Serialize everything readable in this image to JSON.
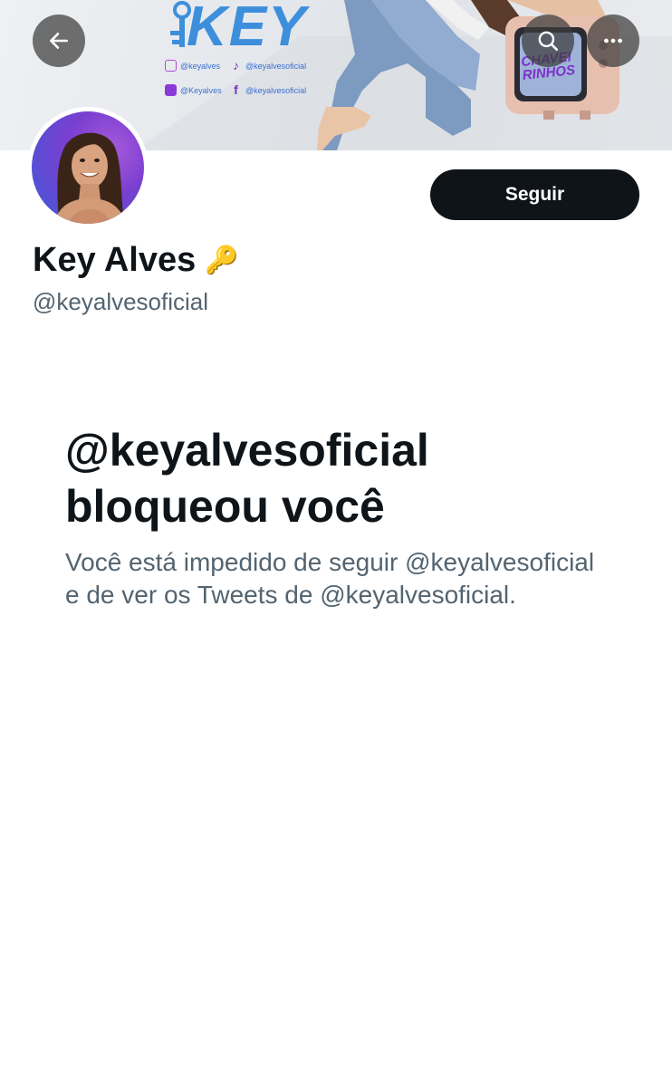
{
  "banner": {
    "brand": "KEY",
    "socials": [
      {
        "icon": "instagram-icon",
        "text": "@keyalves"
      },
      {
        "icon": "tiktok-icon",
        "text": "@keyalvesoficial"
      },
      {
        "icon": "kwai-icon",
        "text": "@Keyalves"
      },
      {
        "icon": "facebook-icon",
        "text": "@keyalvesoficial"
      }
    ],
    "tv_text_1": "CHAVEI",
    "tv_text_2": "RINHOS"
  },
  "toolbar": {
    "back_icon": "arrow-left-icon",
    "search_icon": "search-icon",
    "more_icon": "more-horizontal-icon"
  },
  "profile": {
    "display_name": "Key Alves",
    "name_emoji": "🔑",
    "handle": "@keyalvesoficial",
    "follow_label": "Seguir"
  },
  "blocked": {
    "title_line_1": "@keyalvesoficial",
    "title_line_2": "bloqueou você",
    "description_line_1": "Você está impedido de seguir @keyalvesoficial",
    "description_line_2": "e de ver os Tweets de @keyalvesoficial."
  },
  "colors": {
    "primary_text": "#0f1419",
    "secondary_text": "#536471",
    "follow_button_bg": "#0f1419",
    "brand_blue": "#3d8fdc",
    "brand_purple": "#7a32c8"
  }
}
